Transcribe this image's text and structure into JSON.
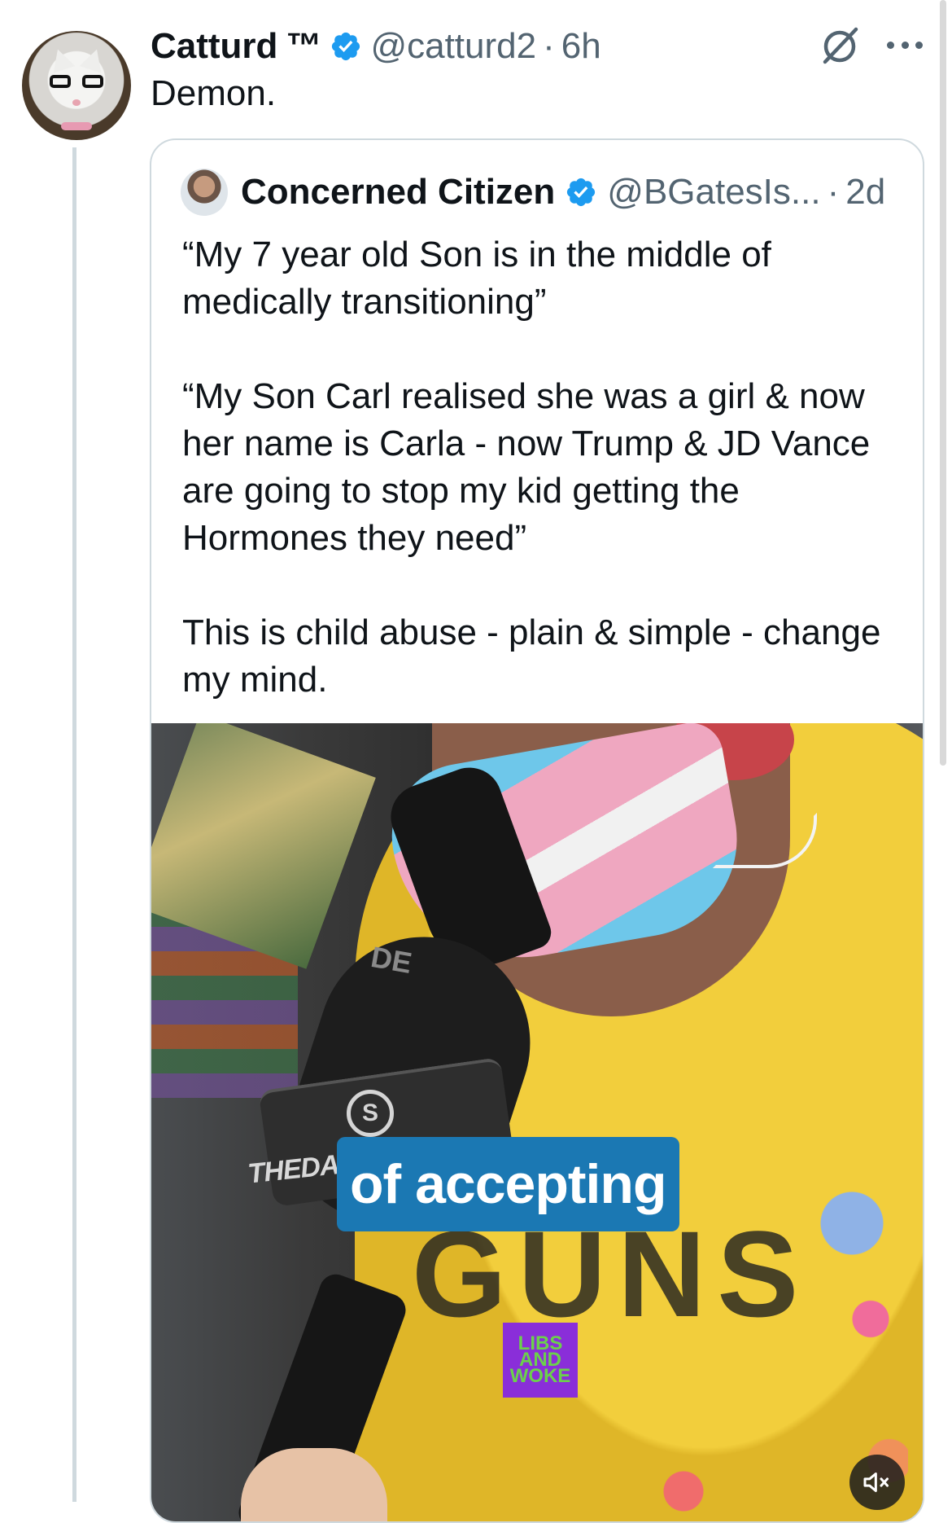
{
  "post": {
    "author_name": "Catturd",
    "author_suffix": "™",
    "verified": true,
    "handle": "@catturd2",
    "separator": "·",
    "time": "6h",
    "text": "Demon."
  },
  "quoted_post": {
    "author_name": "Concerned Citizen",
    "verified": true,
    "handle": "@BGatesIs...",
    "separator": "·",
    "time": "2d",
    "paragraphs": [
      "“My 7 year old Son is in the middle of medically transitioning”",
      "“My Son Carl realised she was a girl & now her name is Carla - now Trump & JD Vance are going to stop my kid getting the Hormones they need”",
      "This is child abuse - plain & simple - change my mind."
    ],
    "media": {
      "caption": "of accepting",
      "mic_brand": "THEDAILYSIGNAL",
      "mic_logo": "S",
      "mic_fragment": "DE",
      "shirt_text": "GUNS",
      "watermark_lines": [
        "LIBS",
        "AND",
        "WOKE"
      ]
    }
  },
  "icons": {
    "verified": "verified-badge-icon",
    "grok": "grok-icon",
    "more": "more-options-icon",
    "mute": "speaker-muted-icon"
  },
  "colors": {
    "verified": "#1d9bf0",
    "secondary_text": "#536471",
    "border": "#cfd9de",
    "caption_bg": "#1b78b3",
    "watermark_bg": "#8a2ed9",
    "watermark_text": "#6bd14b"
  }
}
